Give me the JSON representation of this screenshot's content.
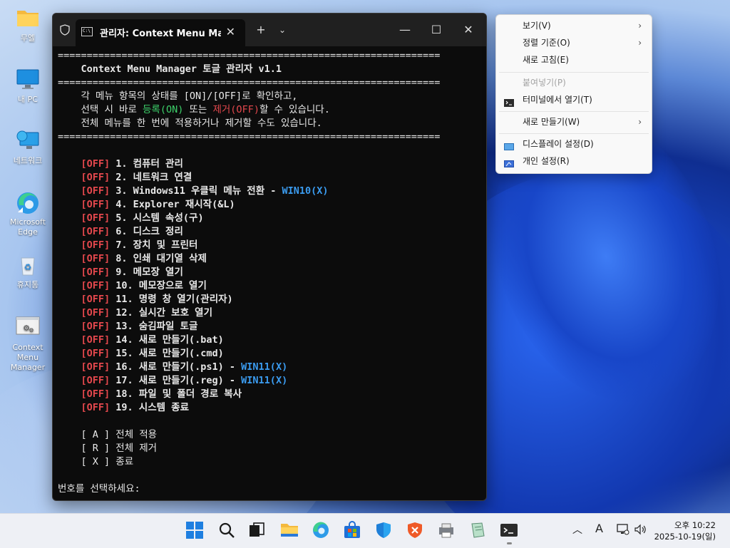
{
  "desktop": {
    "icons": [
      {
        "label": "무엘"
      },
      {
        "label": "내 PC"
      },
      {
        "label": "네트워크"
      },
      {
        "label": "Microsoft Edge"
      },
      {
        "label": "휴지통"
      },
      {
        "label": "Context Menu Manager"
      }
    ]
  },
  "terminal": {
    "tab_title": "관리자: Context Menu Manag",
    "rule": "==================================================================",
    "header": "    Context Menu Manager 토글 관리자 v1.1",
    "intro1": "    각 메뉴 항목의 상태를 [ON]/[OFF]로 확인하고,",
    "intro2_a": "    선택 시 바로 ",
    "intro2_on": "등록(ON)",
    "intro2_b": " 또는 ",
    "intro2_off": "제거(OFF)",
    "intro2_c": "할 수 있습니다.",
    "intro3": "    전체 메뉴를 한 번에 적용하거나 제거할 수도 있습니다.",
    "items": [
      {
        "status": "[OFF]",
        "text": " 1. 컴퓨터 관리",
        "note": ""
      },
      {
        "status": "[OFF]",
        "text": " 2. 네트워크 연결",
        "note": ""
      },
      {
        "status": "[OFF]",
        "text": " 3. Windows11 우클릭 메뉴 전환 - ",
        "note": "WIN10(X)"
      },
      {
        "status": "[OFF]",
        "text": " 4. Explorer 재시작(&L)",
        "note": ""
      },
      {
        "status": "[OFF]",
        "text": " 5. 시스템 속성(구)",
        "note": ""
      },
      {
        "status": "[OFF]",
        "text": " 6. 디스크 정리",
        "note": ""
      },
      {
        "status": "[OFF]",
        "text": " 7. 장치 및 프린터",
        "note": ""
      },
      {
        "status": "[OFF]",
        "text": " 8. 인쇄 대기열 삭제",
        "note": ""
      },
      {
        "status": "[OFF]",
        "text": " 9. 메모장 열기",
        "note": ""
      },
      {
        "status": "[OFF]",
        "text": " 10. 메모장으로 열기",
        "note": ""
      },
      {
        "status": "[OFF]",
        "text": " 11. 명령 창 열기(관리자)",
        "note": ""
      },
      {
        "status": "[OFF]",
        "text": " 12. 실시간 보호 열기",
        "note": ""
      },
      {
        "status": "[OFF]",
        "text": " 13. 숨김파일 토글",
        "note": ""
      },
      {
        "status": "[OFF]",
        "text": " 14. 새로 만들기(.bat)",
        "note": ""
      },
      {
        "status": "[OFF]",
        "text": " 15. 새로 만들기(.cmd)",
        "note": ""
      },
      {
        "status": "[OFF]",
        "text": " 16. 새로 만들기(.ps1) - ",
        "note": "WIN11(X)"
      },
      {
        "status": "[OFF]",
        "text": " 17. 새로 만들기(.reg) - ",
        "note": "WIN11(X)"
      },
      {
        "status": "[OFF]",
        "text": " 18. 파일 및 폴더 경로 복사",
        "note": ""
      },
      {
        "status": "[OFF]",
        "text": " 19. 시스템 종료",
        "note": ""
      }
    ],
    "opt_a": "    [ A ] 전체 적용",
    "opt_r": "    [ R ] 전체 제거",
    "opt_x": "    [ X ] 종료",
    "prompt": "번호를 선택하세요:"
  },
  "context_menu": {
    "view": "보기(V)",
    "sort": "정렬 기준(O)",
    "refresh": "새로 고침(E)",
    "paste": "붙여넣기(P)",
    "terminal": "터미널에서 열기(T)",
    "new": "새로 만들기(W)",
    "display": "디스플레이 설정(D)",
    "personalize": "개인 설정(R)"
  },
  "taskbar": {
    "ime": "A",
    "time": "오후 10:22",
    "date": "2025-10-19(일)"
  },
  "colors": {
    "off": "#e5484d",
    "on": "#3dd16a",
    "note": "#3b9cf0"
  }
}
